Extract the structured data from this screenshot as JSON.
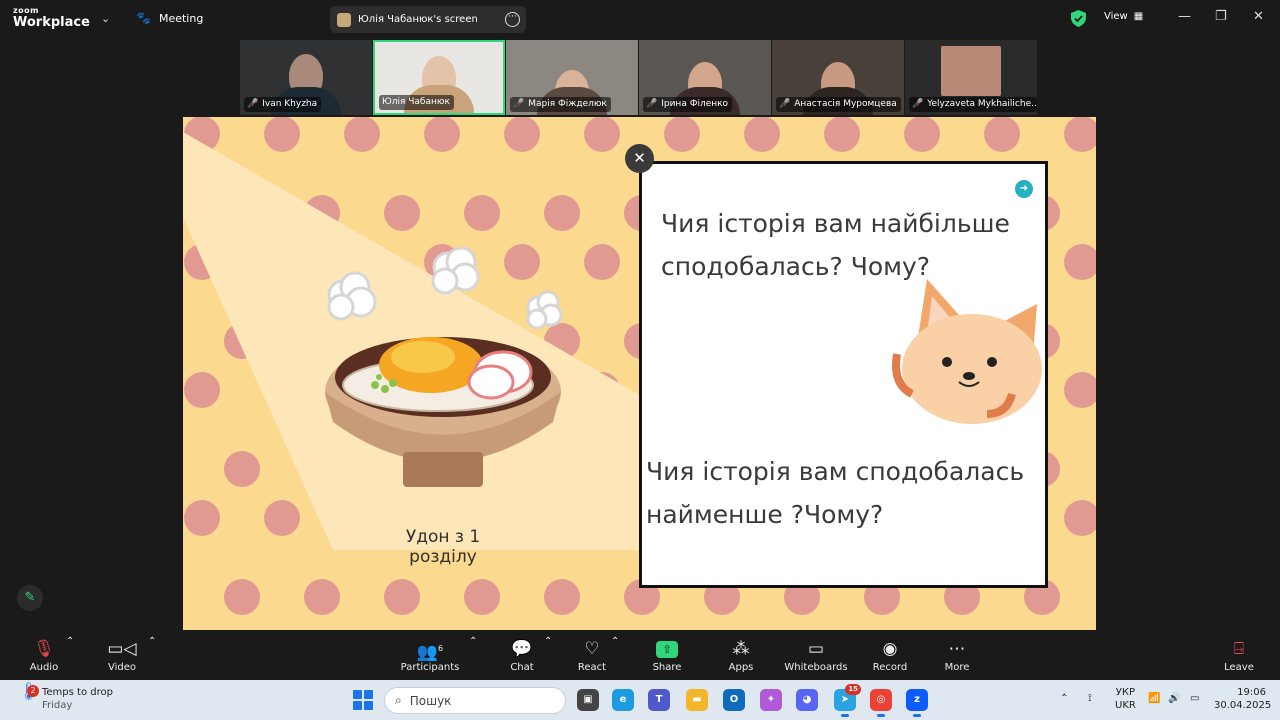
{
  "app": {
    "logo_top": "zoom",
    "logo_bottom": "Workplace",
    "menu_label": "Meeting"
  },
  "share_pill": {
    "label": "Юлія Чабанюк's screen"
  },
  "topbar": {
    "view_label": "View"
  },
  "participants": [
    {
      "name": "Ivan Khyzha",
      "muted": true,
      "active": false
    },
    {
      "name": "Юлія Чабанюк",
      "muted": false,
      "active": true
    },
    {
      "name": "Марія Фіжделюк",
      "muted": true,
      "active": false
    },
    {
      "name": "Ірина Філенко",
      "muted": true,
      "active": false
    },
    {
      "name": "Анастасія Муромцева",
      "muted": true,
      "active": false
    },
    {
      "name": "Yelyzaveta Mykhailiche...",
      "muted": true,
      "active": false
    }
  ],
  "slide": {
    "question1": "Чия історія вам найбільше сподобалась? Чому?",
    "question2": "Чия історія вам сподобалась найменше ?Чому?",
    "image_caption": "Удон з 1 розділу"
  },
  "toolbar": {
    "audio": "Audio",
    "video": "Video",
    "participants": "Participants",
    "participants_count": "6",
    "chat": "Chat",
    "react": "React",
    "share": "Share",
    "apps": "Apps",
    "whiteboards": "Whiteboards",
    "record": "Record",
    "more": "More",
    "leave": "Leave"
  },
  "taskbar": {
    "weather_title": "Temps to drop",
    "weather_sub": "Friday",
    "weather_badge": "2",
    "search_placeholder": "Пошук",
    "lang_top": "УКР",
    "lang_bottom": "UKR",
    "time": "19:06",
    "date": "30.04.2025",
    "badge_telegram": "15"
  },
  "colors": {
    "slide_bg": "#fbd98e",
    "dot": "#e19a92",
    "accent_green": "#2fd67a",
    "muted_red": "#e5484d"
  }
}
